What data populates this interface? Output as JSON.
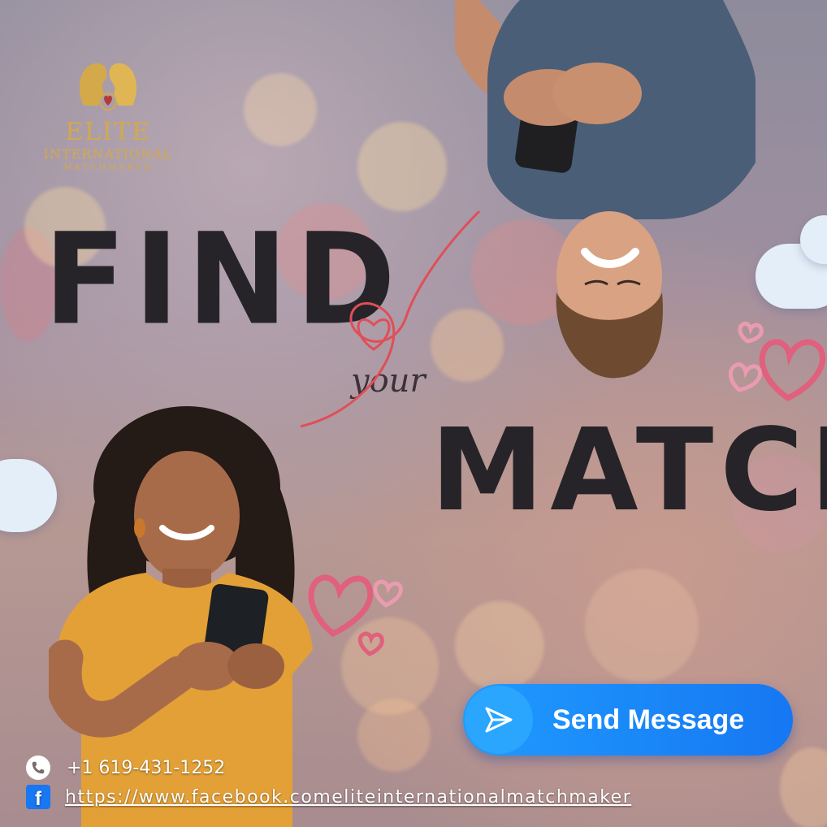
{
  "logo": {
    "title": "ELITE",
    "subtitle": "INTERNATIONAL",
    "tagline": "MATCHMAKER",
    "color": "#d4a94a"
  },
  "headline": {
    "line1": "FIND",
    "connector": "your",
    "line2": "MATCH"
  },
  "cta": {
    "label": "Send Message",
    "icon": "send-icon",
    "color": "#1f8cff"
  },
  "contact": {
    "phone_icon": "phone-icon",
    "phone": "+1 619-431-1252",
    "facebook_icon": "facebook-icon",
    "facebook_url": "https://www.facebook.comeliteinternationalmatchmaker"
  }
}
